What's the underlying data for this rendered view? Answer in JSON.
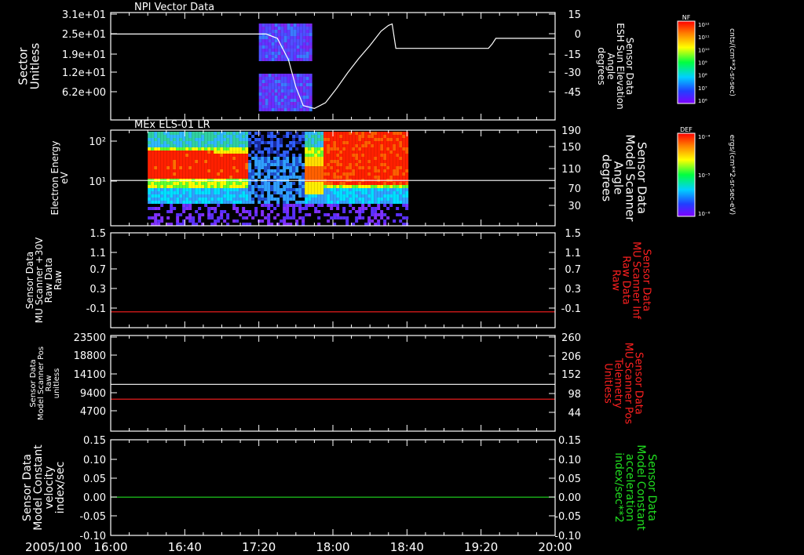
{
  "footer": {
    "date": "2005/100"
  },
  "time_axis": {
    "start": "16:00",
    "end": "20:00",
    "tick_labels": [
      "16:00",
      "16:40",
      "17:20",
      "18:00",
      "18:40",
      "19:20",
      "20:00"
    ]
  },
  "colorbars": [
    {
      "label": "NF",
      "unit": "cnts/(cm**2-sr-sec)",
      "tick_labels": [
        "10¹²",
        "10¹¹",
        "10¹⁰",
        "10⁹",
        "10⁸",
        "10⁷",
        "10⁶"
      ]
    },
    {
      "label": "DEF",
      "unit": "ergs/(cm**2-sr-sec-eV)",
      "tick_labels": [
        "10⁻⁴",
        "10⁻⁵",
        "10⁻⁶"
      ]
    }
  ],
  "chart_data": [
    {
      "type": "heatmap",
      "title": "NPI Vector Data",
      "ylabel": [
        "Sector",
        "Unitless"
      ],
      "ytick_labels": [
        "3.1e+01",
        "2.5e+01",
        "1.9e+01",
        "1.2e+01",
        "6.2e+00"
      ],
      "ylabel_right": [
        "Sensor Data",
        "ESH Sun Elevation",
        "Angle",
        "degrees"
      ],
      "ytick_labels_right": [
        "15",
        "0",
        "-15",
        "-30",
        "-45"
      ],
      "ylim_right": [
        -60,
        15
      ],
      "data_interval": [
        "17:20",
        "17:48"
      ],
      "overlay_line": {
        "x": [
          "16:00",
          "17:24",
          "17:30",
          "17:36",
          "17:40",
          "17:44",
          "17:50",
          "17:56",
          "18:02",
          "18:08",
          "18:14",
          "18:20",
          "18:26",
          "18:30",
          "18:32",
          "18:34",
          "18:38",
          "18:50",
          "19:10",
          "19:24",
          "19:26",
          "19:28",
          "19:40",
          "20:00"
        ],
        "y": [
          0,
          0,
          -3,
          -18,
          -37,
          -50,
          -52,
          -48,
          -38,
          -27,
          -17,
          -8,
          2,
          6,
          7,
          -10,
          -10,
          -10,
          -10,
          -10,
          -7,
          -3,
          -3,
          -3
        ]
      }
    },
    {
      "type": "heatmap",
      "title": "MEx ELS-01 LR",
      "ylabel": [
        "Electron Energy",
        "eV"
      ],
      "ytick_labels": [
        "10²",
        "10¹"
      ],
      "ylabel_right": [
        "Sensor Data",
        "Model Scanner",
        "Angle",
        "degrees"
      ],
      "ytick_labels_right": [
        "190",
        "150",
        "110",
        "70",
        "30"
      ],
      "ylim_right": [
        0,
        190
      ],
      "data_interval": [
        "16:20",
        "18:40"
      ],
      "overlay_line": {
        "x": [
          "16:00",
          "20:00"
        ],
        "y": [
          90,
          90
        ]
      }
    },
    {
      "type": "line",
      "ylabel": [
        "Sensor Data",
        "MU Scanner +30V",
        "Raw Data",
        "Raw"
      ],
      "ytick_labels": [
        "1.5",
        "1.1",
        "0.7",
        "0.3",
        "-0.1"
      ],
      "ylim": [
        -0.3,
        1.5
      ],
      "ylabel_right": [
        "Sensor Data",
        "MU Scanner Inf",
        "Raw Data",
        "Raw"
      ],
      "ytick_labels_right": [
        "1.5",
        "1.1",
        "0.7",
        "0.3",
        "-0.1"
      ],
      "series": [
        {
          "name": "MU Scanner Inf",
          "color": "#ff2020",
          "axis": "right",
          "x": [
            "16:00",
            "20:00"
          ],
          "y": [
            0.0,
            0.0
          ]
        }
      ]
    },
    {
      "type": "line",
      "ylabel": [
        "Sensor Data",
        "Model Scanner Pos",
        "Raw",
        "unitless"
      ],
      "ytick_labels": [
        "23500",
        "18800",
        "14100",
        "9400",
        "4700"
      ],
      "ylim": [
        0,
        23500
      ],
      "ylabel_right": [
        "Sensor Data",
        "MU Scanner Pos",
        "Telemetry",
        "Unitless"
      ],
      "ytick_labels_right": [
        "260",
        "206",
        "152",
        "98",
        "44"
      ],
      "ylim_right": [
        0,
        260
      ],
      "series": [
        {
          "name": "Model Scanner Pos",
          "color": "#ffffff",
          "axis": "left",
          "x": [
            "16:00",
            "20:00"
          ],
          "y": [
            11500,
            11500
          ]
        },
        {
          "name": "MU Scanner Pos",
          "color": "#ff2020",
          "axis": "right",
          "x": [
            "16:00",
            "20:00"
          ],
          "y": [
            87,
            87
          ]
        }
      ]
    },
    {
      "type": "line",
      "ylabel": [
        "Sensor Data",
        "Model Constant",
        "velocity",
        "index/sec"
      ],
      "ytick_labels": [
        "0.15",
        "0.10",
        "0.05",
        "0.00",
        "-0.05",
        "-0.10"
      ],
      "ylim": [
        -0.1,
        0.15
      ],
      "ylabel_right": [
        "Sensor Data",
        "Model Constant",
        "acceleration",
        "index/sec**2"
      ],
      "ytick_labels_right": [
        "0.15",
        "0.10",
        "0.05",
        "0.00",
        "-0.05",
        "-0.10"
      ],
      "series": [
        {
          "name": "Model Constant acceleration",
          "color": "#20dd20",
          "axis": "right",
          "x": [
            "16:00",
            "20:00"
          ],
          "y": [
            0.0,
            0.0
          ]
        }
      ]
    }
  ]
}
